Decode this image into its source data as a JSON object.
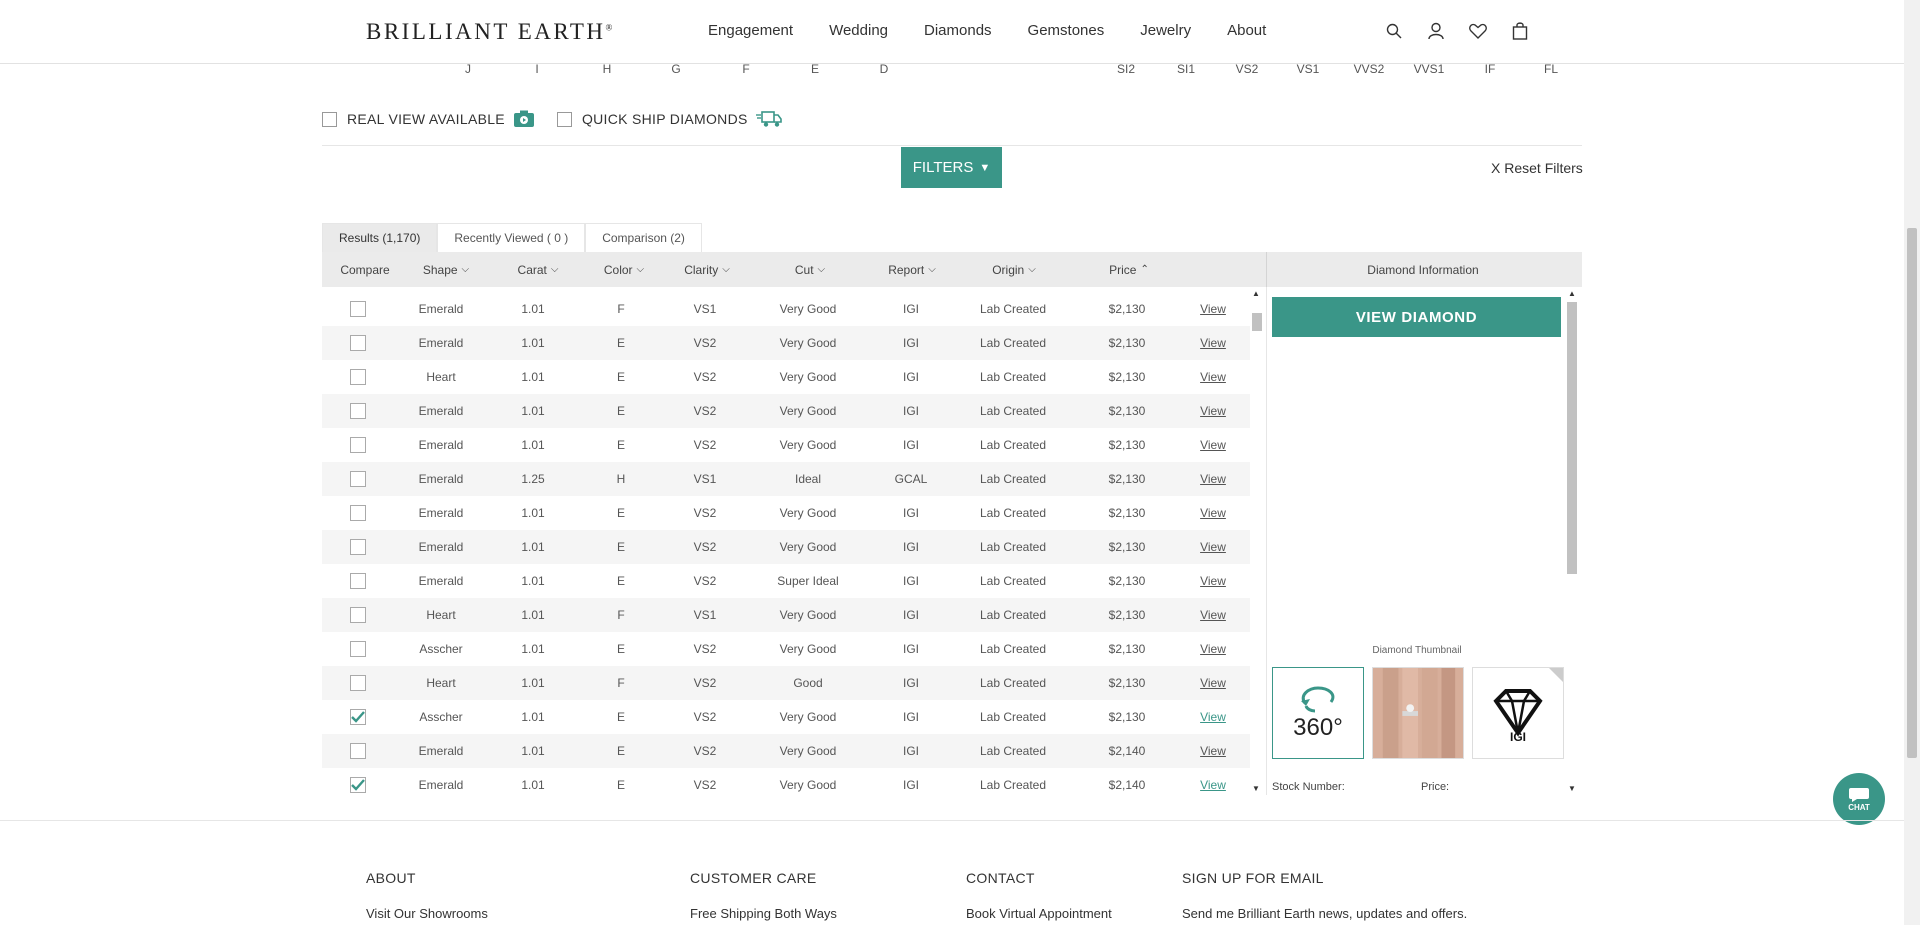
{
  "header": {
    "logo": "BRILLIANT EARTH",
    "nav": [
      "Engagement",
      "Wedding",
      "Diamonds",
      "Gemstones",
      "Jewelry",
      "About"
    ]
  },
  "color_scale": [
    "J",
    "I",
    "H",
    "G",
    "F",
    "E",
    "D"
  ],
  "clarity_scale": [
    "SI2",
    "SI1",
    "VS2",
    "VS1",
    "VVS2",
    "VVS1",
    "IF",
    "FL"
  ],
  "options": {
    "real_view": "REAL VIEW AVAILABLE",
    "quick_ship": "QUICK SHIP DIAMONDS"
  },
  "filters_label": "FILTERS",
  "reset_label": "X Reset Filters",
  "tabs": [
    "Results (1,170)",
    "Recently Viewed ( 0 )",
    "Comparison (2)"
  ],
  "columns": [
    "Compare",
    "Shape",
    "Carat",
    "Color",
    "Clarity",
    "Cut",
    "Report",
    "Origin",
    "Price"
  ],
  "panel_header": "Diamond Information",
  "view_link": "View",
  "rows": [
    {
      "shape": "Emerald",
      "carat": "1.01",
      "color": "F",
      "clarity": "VS1",
      "cut": "Very Good",
      "report": "IGI",
      "origin": "Lab Created",
      "price": "$2,130",
      "checked": false
    },
    {
      "shape": "Emerald",
      "carat": "1.01",
      "color": "E",
      "clarity": "VS2",
      "cut": "Very Good",
      "report": "IGI",
      "origin": "Lab Created",
      "price": "$2,130",
      "checked": false
    },
    {
      "shape": "Heart",
      "carat": "1.01",
      "color": "E",
      "clarity": "VS2",
      "cut": "Very Good",
      "report": "IGI",
      "origin": "Lab Created",
      "price": "$2,130",
      "checked": false
    },
    {
      "shape": "Emerald",
      "carat": "1.01",
      "color": "E",
      "clarity": "VS2",
      "cut": "Very Good",
      "report": "IGI",
      "origin": "Lab Created",
      "price": "$2,130",
      "checked": false
    },
    {
      "shape": "Emerald",
      "carat": "1.01",
      "color": "E",
      "clarity": "VS2",
      "cut": "Very Good",
      "report": "IGI",
      "origin": "Lab Created",
      "price": "$2,130",
      "checked": false
    },
    {
      "shape": "Emerald",
      "carat": "1.25",
      "color": "H",
      "clarity": "VS1",
      "cut": "Ideal",
      "report": "GCAL",
      "origin": "Lab Created",
      "price": "$2,130",
      "checked": false
    },
    {
      "shape": "Emerald",
      "carat": "1.01",
      "color": "E",
      "clarity": "VS2",
      "cut": "Very Good",
      "report": "IGI",
      "origin": "Lab Created",
      "price": "$2,130",
      "checked": false
    },
    {
      "shape": "Emerald",
      "carat": "1.01",
      "color": "E",
      "clarity": "VS2",
      "cut": "Very Good",
      "report": "IGI",
      "origin": "Lab Created",
      "price": "$2,130",
      "checked": false
    },
    {
      "shape": "Emerald",
      "carat": "1.01",
      "color": "E",
      "clarity": "VS2",
      "cut": "Super Ideal",
      "report": "IGI",
      "origin": "Lab Created",
      "price": "$2,130",
      "checked": false
    },
    {
      "shape": "Heart",
      "carat": "1.01",
      "color": "F",
      "clarity": "VS1",
      "cut": "Very Good",
      "report": "IGI",
      "origin": "Lab Created",
      "price": "$2,130",
      "checked": false
    },
    {
      "shape": "Asscher",
      "carat": "1.01",
      "color": "E",
      "clarity": "VS2",
      "cut": "Very Good",
      "report": "IGI",
      "origin": "Lab Created",
      "price": "$2,130",
      "checked": false
    },
    {
      "shape": "Heart",
      "carat": "1.01",
      "color": "F",
      "clarity": "VS2",
      "cut": "Good",
      "report": "IGI",
      "origin": "Lab Created",
      "price": "$2,130",
      "checked": false
    },
    {
      "shape": "Asscher",
      "carat": "1.01",
      "color": "E",
      "clarity": "VS2",
      "cut": "Very Good",
      "report": "IGI",
      "origin": "Lab Created",
      "price": "$2,130",
      "checked": true
    },
    {
      "shape": "Emerald",
      "carat": "1.01",
      "color": "E",
      "clarity": "VS2",
      "cut": "Very Good",
      "report": "IGI",
      "origin": "Lab Created",
      "price": "$2,140",
      "checked": false
    },
    {
      "shape": "Emerald",
      "carat": "1.01",
      "color": "E",
      "clarity": "VS2",
      "cut": "Very Good",
      "report": "IGI",
      "origin": "Lab Created",
      "price": "$2,140",
      "checked": true
    }
  ],
  "panel": {
    "view_diamond": "VIEW DIAMOND",
    "thumbnail_label": "Diamond Thumbnail",
    "thumb_360": "360°",
    "stock_label": "Stock Number:",
    "price_label": "Price:"
  },
  "chat_label": "CHAT",
  "footer": {
    "about": {
      "title": "ABOUT",
      "link": "Visit Our Showrooms"
    },
    "care": {
      "title": "CUSTOMER CARE",
      "link": "Free Shipping Both Ways"
    },
    "contact": {
      "title": "CONTACT",
      "link": "Book Virtual Appointment"
    },
    "email": {
      "title": "SIGN UP FOR EMAIL",
      "link": "Send me Brilliant Earth news, updates and offers."
    }
  },
  "colors": {
    "accent": "#3a9688",
    "row_alt": "#f5f5f5",
    "header_bar": "#ebebeb"
  }
}
